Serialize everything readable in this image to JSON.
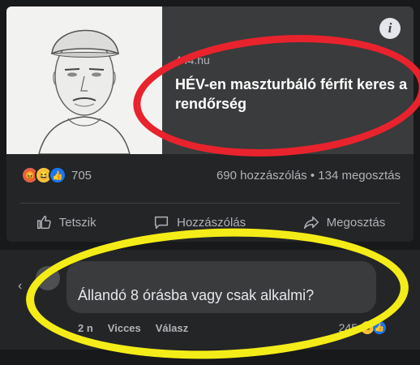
{
  "link_preview": {
    "domain": "444.hu",
    "headline": "HÉV-en maszturbáló férfit keres a rendőrség",
    "info_icon": "info-icon"
  },
  "stats": {
    "reaction_icons": [
      "angry-icon",
      "haha-icon",
      "like-icon"
    ],
    "reaction_count": "705",
    "engagement": "690 hozzászólás • 134 megosztás"
  },
  "actions": [
    {
      "label": "Tetszik",
      "icon": "thumbs-up-icon"
    },
    {
      "label": "Hozzászólás",
      "icon": "comment-icon"
    },
    {
      "label": "Megosztás",
      "icon": "share-icon"
    }
  ],
  "comment": {
    "text": "Állandó 8 órásba vagy csak alkalmi?",
    "meta": {
      "age": "2 n",
      "funny": "Vicces",
      "reply": "Válasz"
    },
    "reaction_count": "245"
  },
  "annotations": {
    "red_ring_color": "#e8232d",
    "yellow_ring_color": "#f4ec18"
  }
}
